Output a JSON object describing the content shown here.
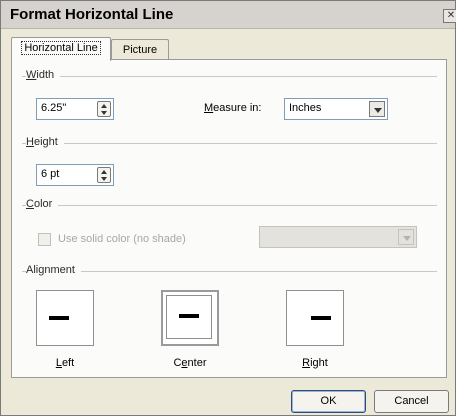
{
  "dialog": {
    "title": "Format Horizontal Line",
    "close_glyph": "✕"
  },
  "tabs": [
    {
      "label": "Horizontal Line",
      "active": true
    },
    {
      "label": "Picture",
      "active": false
    }
  ],
  "width": {
    "group_label": "Width",
    "value": "6.25\"",
    "measure_label": "Measure in:",
    "measure_value": "Inches"
  },
  "height": {
    "group_label": "Height",
    "value": "6 pt"
  },
  "color": {
    "group_label": "Color",
    "solid_label": "Use solid color (no shade)",
    "solid_checked": false,
    "color_value": ""
  },
  "alignment": {
    "group_label": "Alignment",
    "options": [
      {
        "label": "Left",
        "selected": false
      },
      {
        "label": "Center",
        "selected": true
      },
      {
        "label": "Right",
        "selected": false
      }
    ]
  },
  "buttons": {
    "ok": "OK",
    "cancel": "Cancel"
  },
  "icons": {
    "close": "close-icon",
    "spin": "spin-arrows-icon",
    "dropdown": "chevron-down-icon"
  }
}
